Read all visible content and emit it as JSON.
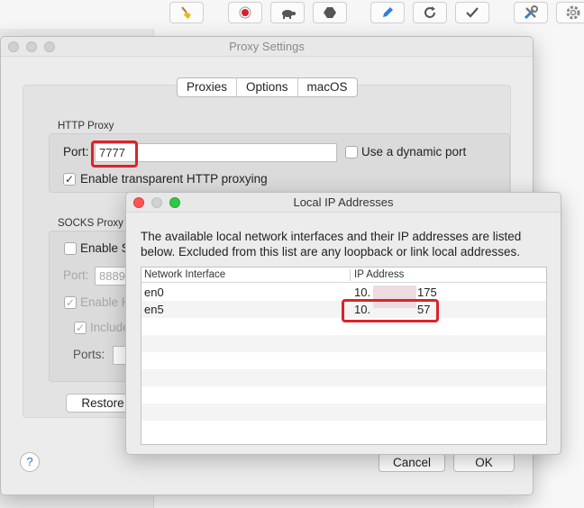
{
  "toolbar": {
    "icons": [
      "broom-icon",
      "record-icon",
      "turtle-icon",
      "stop-hexagon-icon",
      "pen-icon",
      "refresh-icon",
      "checkmark-icon",
      "tools-icon",
      "gear-icon"
    ]
  },
  "proxy_window": {
    "title": "Proxy Settings",
    "tabs": [
      "Proxies",
      "Options",
      "macOS"
    ],
    "http_proxy": {
      "section_label": "HTTP Proxy",
      "port_label": "Port:",
      "port_value": "7777",
      "dynamic_port_label": "Use a dynamic port",
      "dynamic_port_checked": false,
      "transparent_label": "Enable transparent HTTP proxying",
      "transparent_checked": true
    },
    "socks_proxy": {
      "section_label": "SOCKS Proxy",
      "enable_label": "Enable S",
      "port_label": "Port:",
      "port_value": "8889",
      "enable_h_label": "Enable H",
      "include_label": "Include",
      "ports_label": "Ports:"
    },
    "restore_label": "Restore",
    "help_label": "?",
    "cancel_label": "Cancel",
    "ok_label": "OK"
  },
  "ip_window": {
    "title": "Local IP Addresses",
    "description": "The available local network interfaces and their IP addresses are listed below.  Excluded from this list are any loopback or link local addresses.",
    "columns": [
      "Network Interface",
      "IP Address"
    ],
    "rows": [
      {
        "interface": "en0",
        "ip_prefix": "10.",
        "ip_suffix": "175"
      },
      {
        "interface": "en5",
        "ip_prefix": "10.",
        "ip_suffix": "57"
      }
    ]
  },
  "colors": {
    "highlight": "#d9232b",
    "close": "#fc5753",
    "zoom": "#33c748"
  }
}
